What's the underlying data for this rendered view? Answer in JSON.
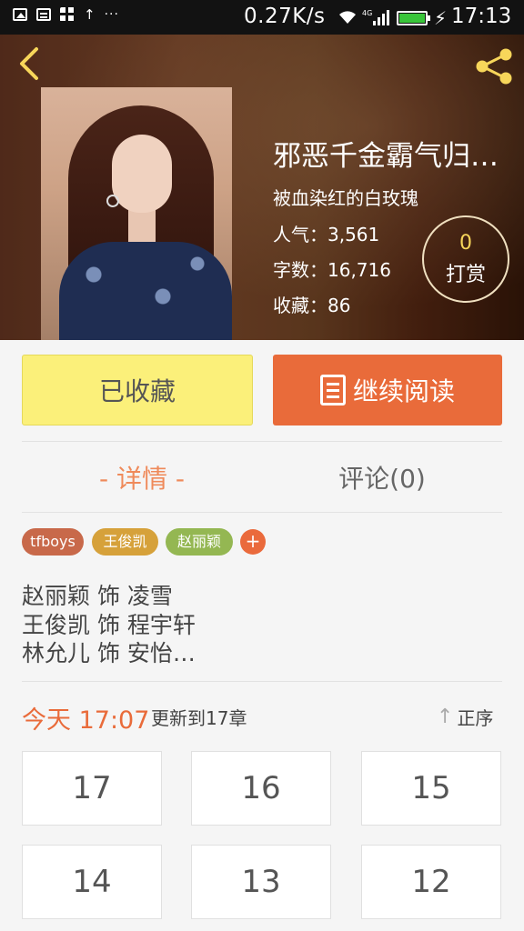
{
  "status_bar": {
    "net_speed": "0.27K/s",
    "time": "17:13",
    "battery_color": "#39c53a",
    "icons": [
      "image-icon",
      "message-icon",
      "apps-icon",
      "upload-arrow-icon",
      "more-dots-icon",
      "wifi-icon",
      "signal-4g-icon",
      "battery-icon",
      "charging-icon"
    ]
  },
  "header": {
    "title": "邪恶千金霸气归…",
    "author": "被血染红的白玫瑰",
    "popularity": "人气：3,561",
    "word_count": "字数：16,716",
    "favorites": "收藏：86",
    "tip_count": "0",
    "tip_label": "打赏",
    "back_icon": "chevron-left-icon",
    "share_icon": "share-icon",
    "accent_color": "#f7d65a"
  },
  "actions": {
    "favorited_label": "已收藏",
    "continue_label": "继续阅读",
    "favorited_color": "#fbf07a",
    "continue_color": "#e96b3a"
  },
  "tabs": {
    "detail": "- 详情 -",
    "comments": "评论(0)"
  },
  "tags": [
    "tfboys",
    "王俊凯",
    "赵丽颖",
    "+"
  ],
  "cast": [
    "赵丽颖  饰  凌雪",
    "王俊凯  饰  程宇轩",
    "林允儿  饰  安怡…"
  ],
  "update": {
    "time": "今天 17:07",
    "text": "更新到17章",
    "sort_label": "正序",
    "sort_arrow": "↑"
  },
  "chapters": [
    "17",
    "16",
    "15",
    "14",
    "13",
    "12"
  ]
}
